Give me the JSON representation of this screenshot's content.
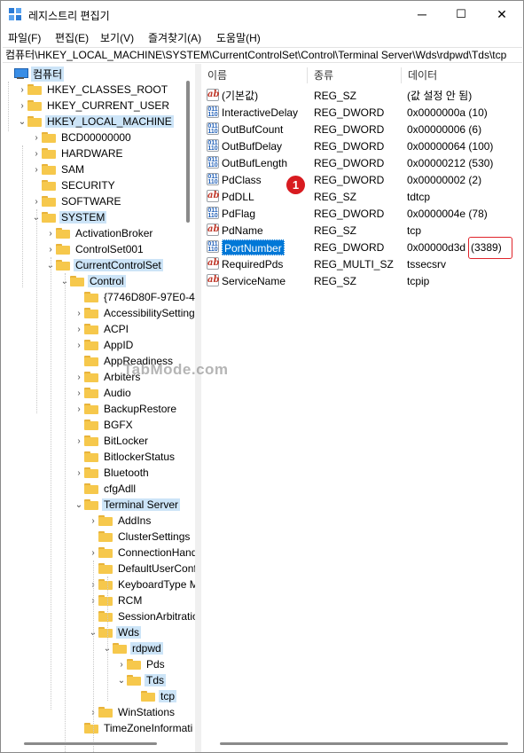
{
  "window": {
    "title": "레지스트리 편집기",
    "buttons": {
      "minimize": "─",
      "maximize": "☐",
      "close": "✕"
    }
  },
  "menu": [
    {
      "label": "파일(F)"
    },
    {
      "label": "편집(E)"
    },
    {
      "label": "보기(V)"
    },
    {
      "label": "즐겨찾기(A)"
    },
    {
      "label": "도움말(H)"
    }
  ],
  "address": "컴퓨터\\HKEY_LOCAL_MACHINE\\SYSTEM\\CurrentControlSet\\Control\\Terminal Server\\Wds\\rdpwd\\Tds\\tcp",
  "tree": [
    {
      "label": "컴퓨터",
      "icon": "computer-icon",
      "selected": true,
      "chevron": ""
    },
    {
      "label": "HKEY_CLASSES_ROOT",
      "chevron": "›"
    },
    {
      "label": "HKEY_CURRENT_USER",
      "chevron": "›"
    },
    {
      "label": "HKEY_LOCAL_MACHINE",
      "chevron": "⌄",
      "selected": true
    },
    {
      "label": "BCD00000000",
      "chevron": "›"
    },
    {
      "label": "HARDWARE",
      "chevron": "›"
    },
    {
      "label": "SAM",
      "chevron": "›"
    },
    {
      "label": "SECURITY",
      "chevron": ""
    },
    {
      "label": "SOFTWARE",
      "chevron": "›"
    },
    {
      "label": "SYSTEM",
      "chevron": "⌄",
      "selected": true
    },
    {
      "label": "ActivationBroker",
      "chevron": "›"
    },
    {
      "label": "ControlSet001",
      "chevron": "›"
    },
    {
      "label": "CurrentControlSet",
      "chevron": "⌄",
      "selected": true
    },
    {
      "label": "Control",
      "chevron": "⌄",
      "selected": true
    },
    {
      "label": "{7746D80F-97E0-4E2",
      "chevron": ""
    },
    {
      "label": "AccessibilitySetting",
      "chevron": "›"
    },
    {
      "label": "ACPI",
      "chevron": "›"
    },
    {
      "label": "AppID",
      "chevron": "›"
    },
    {
      "label": "AppReadiness",
      "chevron": ""
    },
    {
      "label": "Arbiters",
      "chevron": "›"
    },
    {
      "label": "Audio",
      "chevron": "›"
    },
    {
      "label": "BackupRestore",
      "chevron": "›"
    },
    {
      "label": "BGFX",
      "chevron": ""
    },
    {
      "label": "BitLocker",
      "chevron": "›"
    },
    {
      "label": "BitlockerStatus",
      "chevron": ""
    },
    {
      "label": "Bluetooth",
      "chevron": "›"
    },
    {
      "label": "cfgAdll",
      "chevron": ""
    },
    {
      "label": "Terminal Server",
      "chevron": "⌄",
      "selected": true
    },
    {
      "label": "AddIns",
      "chevron": "›"
    },
    {
      "label": "ClusterSettings",
      "chevron": ""
    },
    {
      "label": "ConnectionHand",
      "chevron": "›"
    },
    {
      "label": "DefaultUserConf",
      "chevron": ""
    },
    {
      "label": "KeyboardType M",
      "chevron": "›"
    },
    {
      "label": "RCM",
      "chevron": "›"
    },
    {
      "label": "SessionArbitratio",
      "chevron": ""
    },
    {
      "label": "Wds",
      "chevron": "⌄",
      "selected": true
    },
    {
      "label": "rdpwd",
      "chevron": "⌄",
      "selected": true
    },
    {
      "label": "Pds",
      "chevron": "›"
    },
    {
      "label": "Tds",
      "chevron": "⌄",
      "selected": true
    },
    {
      "label": "tcp",
      "chevron": "",
      "selected": true
    },
    {
      "label": "WinStations",
      "chevron": "›"
    },
    {
      "label": "TimeZoneInformati",
      "chevron": ""
    }
  ],
  "list": {
    "columns": {
      "name": "이름",
      "type": "종류",
      "data": "데이터"
    },
    "rows": [
      {
        "name": "(기본값)",
        "type": "REG_SZ",
        "data": "(값 설정 안 됨)",
        "kind": "sz"
      },
      {
        "name": "InteractiveDelay",
        "type": "REG_DWORD",
        "data": "0x0000000a (10)",
        "kind": "dw"
      },
      {
        "name": "OutBufCount",
        "type": "REG_DWORD",
        "data": "0x00000006 (6)",
        "kind": "dw"
      },
      {
        "name": "OutBufDelay",
        "type": "REG_DWORD",
        "data": "0x00000064 (100)",
        "kind": "dw"
      },
      {
        "name": "OutBufLength",
        "type": "REG_DWORD",
        "data": "0x00000212 (530)",
        "kind": "dw"
      },
      {
        "name": "PdClass",
        "type": "REG_DWORD",
        "data": "0x00000002 (2)",
        "kind": "dw"
      },
      {
        "name": "PdDLL",
        "type": "REG_SZ",
        "data": "tdtcp",
        "kind": "sz"
      },
      {
        "name": "PdFlag",
        "type": "REG_DWORD",
        "data": "0x0000004e (78)",
        "kind": "dw"
      },
      {
        "name": "PdName",
        "type": "REG_SZ",
        "data": "tcp",
        "kind": "sz"
      },
      {
        "name": "PortNumber",
        "type": "REG_DWORD",
        "data": "0x00000d3d",
        "data_extra": "(3389)",
        "kind": "dw",
        "selected": true
      },
      {
        "name": "RequiredPds",
        "type": "REG_MULTI_SZ",
        "data": "tssecsrv",
        "kind": "sz"
      },
      {
        "name": "ServiceName",
        "type": "REG_SZ",
        "data": "tcpip",
        "kind": "sz"
      }
    ]
  },
  "annotation": {
    "badge": "1"
  },
  "watermark": "TabMode.com",
  "icons": {
    "string_value": "ab",
    "dword_value": "011 110"
  },
  "colors": {
    "selection": "#cce4f7",
    "focus": "#0078d7",
    "annotation": "#d81b20",
    "folder": "#f6c84c"
  }
}
